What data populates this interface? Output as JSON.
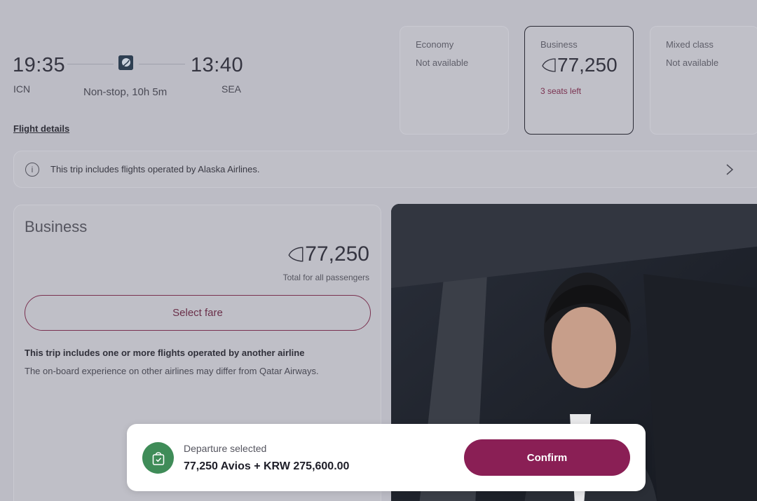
{
  "flight": {
    "departure_time": "19:35",
    "arrival_time": "13:40",
    "origin": "ICN",
    "destination": "SEA",
    "duration": "Non-stop, 10h 5m",
    "details_link": "Flight details"
  },
  "cabins": [
    {
      "name": "Economy",
      "status": "Not available"
    },
    {
      "name": "Business",
      "price": "77,250",
      "seats": "3 seats left"
    },
    {
      "name": "Mixed class",
      "status": "Not available"
    }
  ],
  "info_banner": {
    "text": "This trip includes flights operated by Alaska Airlines."
  },
  "fare_panel": {
    "title": "Business",
    "price": "77,250",
    "total_label": "Total for all passengers",
    "select_label": "Select fare",
    "notice_title": "This trip includes one or more flights operated by another airline",
    "notice_text": "The on-board experience on other airlines may differ from Qatar Airways."
  },
  "toast": {
    "label": "Departure selected",
    "value": "77,250 Avios + KRW 275,600.00",
    "confirm_label": "Confirm"
  },
  "colors": {
    "accent": "#8a1f55",
    "success": "#3f8c58",
    "overlay": "#bcbcc5"
  }
}
